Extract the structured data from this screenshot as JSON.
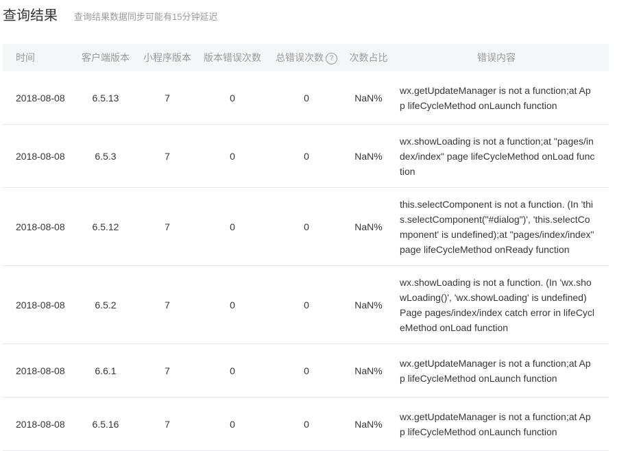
{
  "header": {
    "title": "查询结果",
    "subtitle": "查询结果数据同步可能有15分钟延迟"
  },
  "table": {
    "columns": [
      "时间",
      "客户端版本",
      "小程序版本",
      "版本错误次数",
      "总错误次数",
      "次数占比",
      "错误内容"
    ],
    "help_icon_glyph": "?",
    "rows": [
      {
        "date": "2018-08-08",
        "client_version": "6.5.13",
        "mini_version": "7",
        "version_errors": "0",
        "total_errors": "0",
        "ratio": "NaN%",
        "message": "wx.getUpdateManager is not a function;at App lifeCycleMethod onLaunch function"
      },
      {
        "date": "2018-08-08",
        "client_version": "6.5.3",
        "mini_version": "7",
        "version_errors": "0",
        "total_errors": "0",
        "ratio": "NaN%",
        "message": "wx.showLoading is not a function;at \"pages/index/index\" page lifeCycleMethod onLoad function"
      },
      {
        "date": "2018-08-08",
        "client_version": "6.5.12",
        "mini_version": "7",
        "version_errors": "0",
        "total_errors": "0",
        "ratio": "NaN%",
        "message": "this.selectComponent is not a function. (In 'this.selectComponent(\"#dialog\")', 'this.selectComponent' is undefined);at \"pages/index/index\" page lifeCycleMethod onReady function"
      },
      {
        "date": "2018-08-08",
        "client_version": "6.5.2",
        "mini_version": "7",
        "version_errors": "0",
        "total_errors": "0",
        "ratio": "NaN%",
        "message": "wx.showLoading is not a function. (In 'wx.showLoading()', 'wx.showLoading' is undefined) Page pages/index/index catch error in lifeCycleMethod onLoad function"
      },
      {
        "date": "2018-08-08",
        "client_version": "6.6.1",
        "mini_version": "7",
        "version_errors": "0",
        "total_errors": "0",
        "ratio": "NaN%",
        "message": "wx.getUpdateManager is not a function;at App lifeCycleMethod onLaunch function"
      },
      {
        "date": "2018-08-08",
        "client_version": "6.5.16",
        "mini_version": "7",
        "version_errors": "0",
        "total_errors": "0",
        "ratio": "NaN%",
        "message": "wx.getUpdateManager is not a function;at App lifeCycleMethod onLaunch function"
      }
    ]
  }
}
